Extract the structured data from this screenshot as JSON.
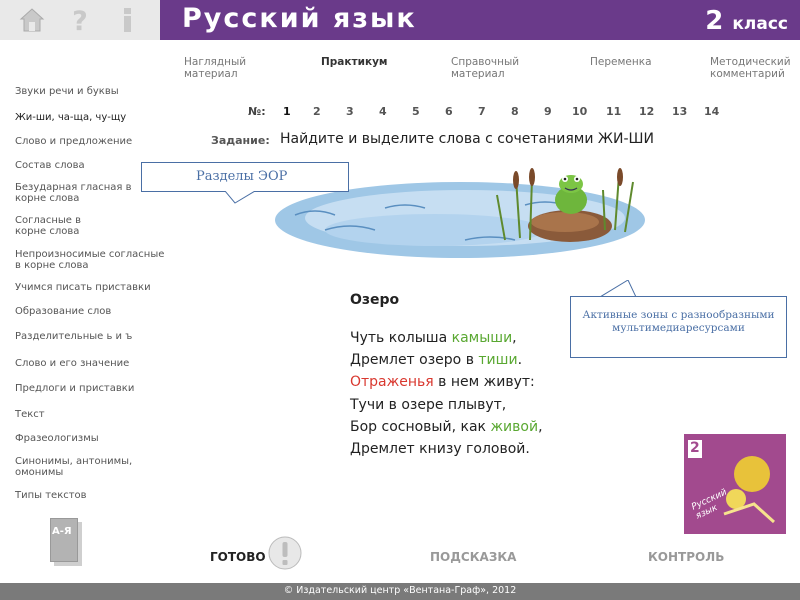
{
  "header": {
    "title": "Русский язык",
    "grade_num": "2",
    "grade_word": "класс"
  },
  "nav": [
    {
      "label": "Наглядный материал"
    },
    {
      "label": "Практикум"
    },
    {
      "label": "Справочный материал"
    },
    {
      "label": "Переменка"
    },
    {
      "label": "Методический комментарий"
    }
  ],
  "sidebar": [
    {
      "label": "Звуки речи и буквы"
    },
    {
      "label": "Жи-ши, ча-ща, чу-щу"
    },
    {
      "label": "Слово и предложение"
    },
    {
      "label": "Состав слова"
    },
    {
      "label": "Безударная гласная в корне слова"
    },
    {
      "label": "Согласные в корне слова"
    },
    {
      "label": "Непроизносимые согласные в корне слова"
    },
    {
      "label": "Учимся писать приставки"
    },
    {
      "label": "Образование слов"
    },
    {
      "label": "Разделительные ь и ъ"
    },
    {
      "label": "Слово и его значение"
    },
    {
      "label": "Предлоги и приставки"
    },
    {
      "label": "Текст"
    },
    {
      "label": "Фразеологизмы"
    },
    {
      "label": "Синонимы, антонимы, омонимы"
    },
    {
      "label": "Типы текстов"
    }
  ],
  "dictionary_icon_text": "А-Я",
  "exercise": {
    "no_label": "№:",
    "numbers": [
      "1",
      "2",
      "3",
      "4",
      "5",
      "6",
      "7",
      "8",
      "9",
      "10",
      "11",
      "12",
      "13",
      "14"
    ],
    "task_label": "Задание:",
    "task_text": "Найдите и выделите слова с сочетаниями ЖИ-ШИ"
  },
  "callouts": {
    "sections": "Разделы ЭОР",
    "active_zones": "Активные зоны с разнообразными мультимедиаресурсами"
  },
  "poem": {
    "title": "Озеро",
    "lines": [
      [
        {
          "t": "Чуть колыша "
        },
        {
          "t": "камыши",
          "c": "g"
        },
        {
          "t": ","
        }
      ],
      [
        {
          "t": "Дремлет озеро в "
        },
        {
          "t": "тиши",
          "c": "g"
        },
        {
          "t": "."
        }
      ],
      [
        {
          "t": "Отраженья",
          "c": "r"
        },
        {
          "t": " в нем живут:"
        }
      ],
      [
        {
          "t": "Тучи в озере плывут,"
        }
      ],
      [
        {
          "t": "Бор сосновый, как "
        },
        {
          "t": "живой",
          "c": "g"
        },
        {
          "t": ","
        }
      ],
      [
        {
          "t": "Дремлет книзу головой."
        }
      ]
    ]
  },
  "bottom": {
    "ready": "ГОТОВО",
    "hint": "ПОДСКАЗКА",
    "control": "КОНТРОЛЬ"
  },
  "footer": "© Издательский центр «Вентана-Граф», 2012",
  "book": {
    "grade": "2",
    "title": "Русский язык"
  },
  "colors": {
    "header": "#6a3a8a",
    "highlight_green": "#5aa832",
    "highlight_red": "#d9382f",
    "callout": "#4a6fa5"
  }
}
